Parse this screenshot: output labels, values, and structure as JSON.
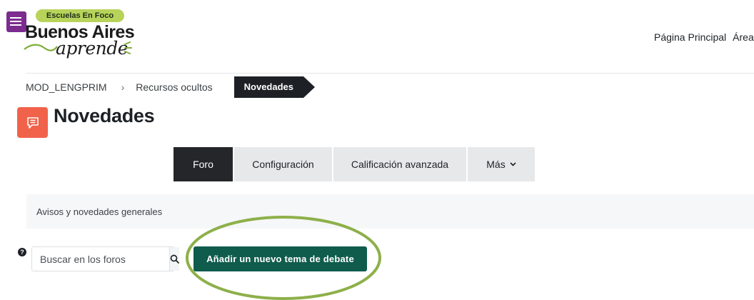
{
  "logo": {
    "pill_text": "Escuelas En Foco",
    "main_text": "Buenos Aires",
    "sub_text": "aprende"
  },
  "topnav": {
    "items": [
      {
        "label": "Página Principal"
      },
      {
        "label": "Área"
      }
    ]
  },
  "breadcrumb": {
    "items": [
      {
        "label": "MOD_LENGPRIM"
      },
      {
        "label": "Recursos ocultos"
      }
    ],
    "current": "Novedades"
  },
  "page": {
    "title": "Novedades",
    "icon": "forum-icon",
    "icon_color": "#f0624a"
  },
  "tabs": [
    {
      "label": "Foro",
      "active": true
    },
    {
      "label": "Configuración",
      "active": false
    },
    {
      "label": "Calificación avanzada",
      "active": false
    },
    {
      "label": "Más",
      "active": false
    }
  ],
  "intro": {
    "text": "Avisos y novedades generales"
  },
  "search": {
    "placeholder": "Buscar en los foros"
  },
  "actions": {
    "add_topic_label": "Añadir un nuevo tema de debate"
  },
  "colors": {
    "accent": "#0f5c4d",
    "drawer": "#7c2b8f",
    "highlight": "#8db04a"
  }
}
